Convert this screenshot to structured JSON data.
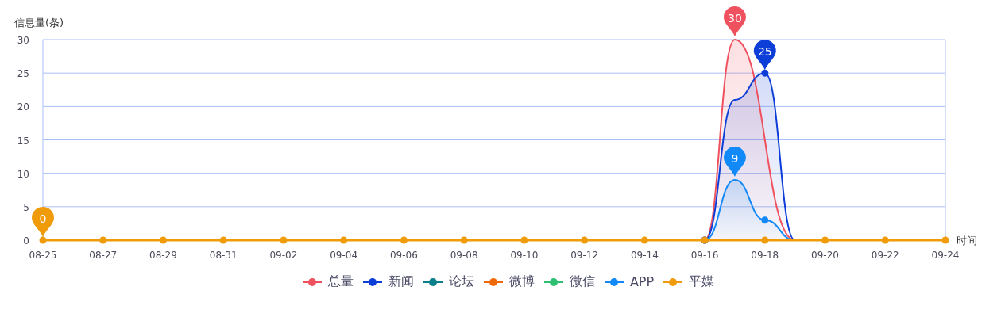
{
  "chart": {
    "chart_data": {
      "type": "line",
      "ylabel": "信息量(条)",
      "xlabel": "时间",
      "grid": true,
      "categories": [
        "08-25",
        null,
        "08-27",
        null,
        "08-29",
        null,
        "08-31",
        null,
        "09-02",
        null,
        "09-04",
        null,
        "09-06",
        null,
        "09-08",
        null,
        "09-10",
        null,
        "09-12",
        null,
        "09-14",
        null,
        "09-16",
        null,
        "09-18",
        null,
        "09-20",
        null,
        "09-22",
        null,
        "09-24"
      ],
      "ylim": [
        0,
        30
      ],
      "yticks": [
        0,
        5,
        10,
        15,
        20,
        25,
        30
      ],
      "series": [
        {
          "name": "总量",
          "color": "#f0515e",
          "values": [
            null,
            null,
            null,
            null,
            null,
            null,
            null,
            null,
            null,
            null,
            null,
            null,
            null,
            null,
            null,
            null,
            null,
            null,
            null,
            null,
            null,
            null,
            0,
            30,
            null,
            0,
            null,
            null,
            null,
            null,
            null
          ]
        },
        {
          "name": "新闻",
          "color": "#0d3ed8",
          "values": [
            null,
            null,
            null,
            null,
            null,
            null,
            null,
            null,
            null,
            null,
            null,
            null,
            null,
            null,
            null,
            null,
            null,
            null,
            null,
            null,
            null,
            null,
            0,
            21,
            25,
            0,
            null,
            null,
            null,
            null,
            null
          ]
        },
        {
          "name": "论坛",
          "color": "#0b7f8a",
          "values": [
            null,
            null,
            null,
            null,
            null,
            null,
            null,
            null,
            null,
            null,
            null,
            null,
            null,
            null,
            null,
            null,
            null,
            null,
            null,
            null,
            null,
            null,
            null,
            null,
            null,
            null,
            null,
            null,
            null,
            null,
            null
          ]
        },
        {
          "name": "微博",
          "color": "#f06a0a",
          "values": [
            null,
            null,
            null,
            null,
            null,
            null,
            null,
            null,
            null,
            null,
            null,
            null,
            null,
            null,
            null,
            null,
            null,
            null,
            null,
            null,
            null,
            null,
            null,
            null,
            null,
            null,
            null,
            null,
            null,
            null,
            null
          ]
        },
        {
          "name": "微信",
          "color": "#2fbf71",
          "values": [
            null,
            null,
            null,
            null,
            null,
            null,
            null,
            null,
            null,
            null,
            null,
            null,
            null,
            null,
            null,
            null,
            null,
            null,
            null,
            null,
            null,
            null,
            null,
            null,
            null,
            null,
            null,
            null,
            null,
            null,
            null
          ]
        },
        {
          "name": "APP",
          "color": "#1289f8",
          "values": [
            null,
            null,
            null,
            null,
            null,
            null,
            null,
            null,
            null,
            null,
            null,
            null,
            null,
            null,
            null,
            null,
            null,
            null,
            null,
            null,
            null,
            null,
            0,
            9,
            3,
            0,
            null,
            null,
            null,
            null,
            null
          ]
        },
        {
          "name": "平媒",
          "color": "#f09b0a",
          "values": [
            0,
            0,
            0,
            0,
            0,
            0,
            0,
            0,
            0,
            0,
            0,
            0,
            0,
            0,
            0,
            0,
            0,
            0,
            0,
            0,
            0,
            0,
            0,
            0,
            0,
            0,
            0,
            0,
            0,
            0,
            0
          ]
        }
      ],
      "annotations": [
        {
          "y": 30,
          "text": "30"
        },
        {
          "y": 25,
          "text": "25"
        },
        {
          "y": 9,
          "text": "9"
        },
        {
          "x": "08-25",
          "y": 0,
          "text": "0"
        }
      ]
    }
  }
}
